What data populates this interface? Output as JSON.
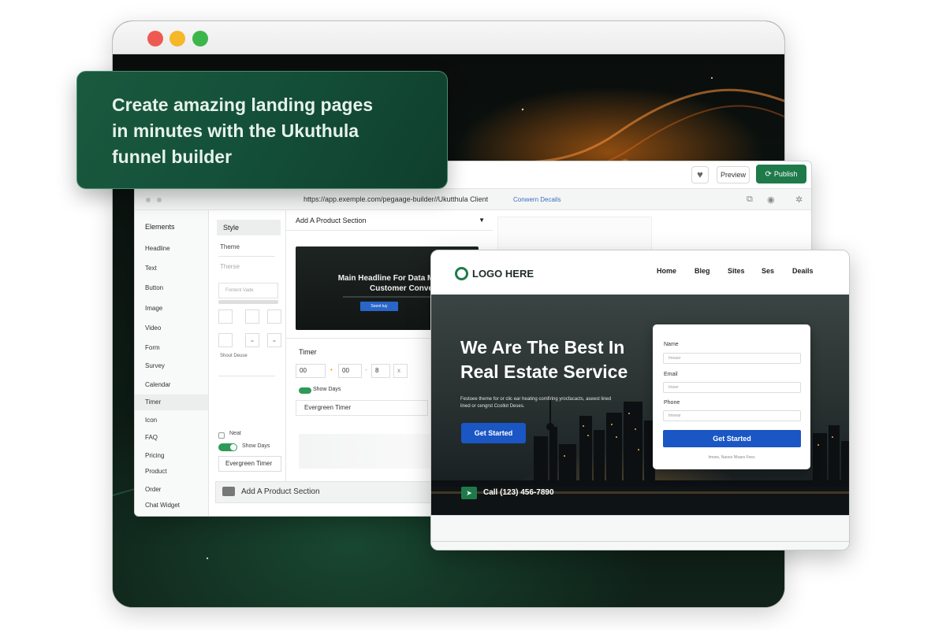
{
  "hero_card": {
    "line1": "Create amazing landing pages",
    "line2": "in minutes with the Ukuthula",
    "line3": "funnel builder"
  },
  "builder": {
    "toolbar": {
      "heart_icon": "heart-icon",
      "preview_label": "Preview",
      "publish_label": "Publish"
    },
    "url": "https://app.exemple.com/pegaage-builder//Ukutthula Client",
    "url_link": "Conwern Decails",
    "elements": {
      "title": "Elements",
      "items": [
        "Headline",
        "Text",
        "Button",
        "Image",
        "Video",
        "Form",
        "Survey",
        "Calendar",
        "Timer",
        "Icon",
        "FAQ",
        "Pricing",
        "Product",
        "Order",
        "Chat Widget"
      ],
      "active": "Timer"
    },
    "style_panel": {
      "tab": "Style",
      "theme_label": "Theme",
      "theme_faint": "Therse",
      "select_placeholder": "Fontent Vade",
      "shout_label": "Shout Deuse",
      "check_label": "Neat",
      "show_days": "Show Days",
      "evergreen": "Evergreen Timer"
    },
    "section": {
      "title": "Add A Product Section",
      "thumb_title": "Main Headline For Data Manage & Customer Conve",
      "thumb_button": "Seent tuy"
    },
    "timer": {
      "title": "Timer",
      "fields": [
        "00",
        "00",
        "8"
      ],
      "show_days": "Show Days",
      "evergreen": "Evergreen Timer"
    },
    "add_bar": "Add A Product Section"
  },
  "landing": {
    "logo": "LOGO HERE",
    "nav": [
      "Home",
      "Bleg",
      "Sites",
      "Ses",
      "Deails"
    ],
    "headline_line1": "We Are The Best In",
    "headline_line2": "Real Estate Service",
    "subtext": "Festoee theme for or clic ear heating comfiring yrocfacacts, aseest lined lined or cengrst Ccollot Deses.",
    "cta": "Get Started",
    "call": "Call (123) 456-7890",
    "form": {
      "name_label": "Name",
      "name_placeholder": "Imoasr",
      "email_label": "Email",
      "email_placeholder": "Imoer",
      "phone_label": "Phone",
      "phone_placeholder": "Imoear",
      "button": "Get Started",
      "note": "Imoes, Naoes Nhaes Fees"
    }
  },
  "colors": {
    "brand_green": "#1f7a4a",
    "cta_blue": "#1a56c4",
    "hero_card": "#14503a"
  }
}
